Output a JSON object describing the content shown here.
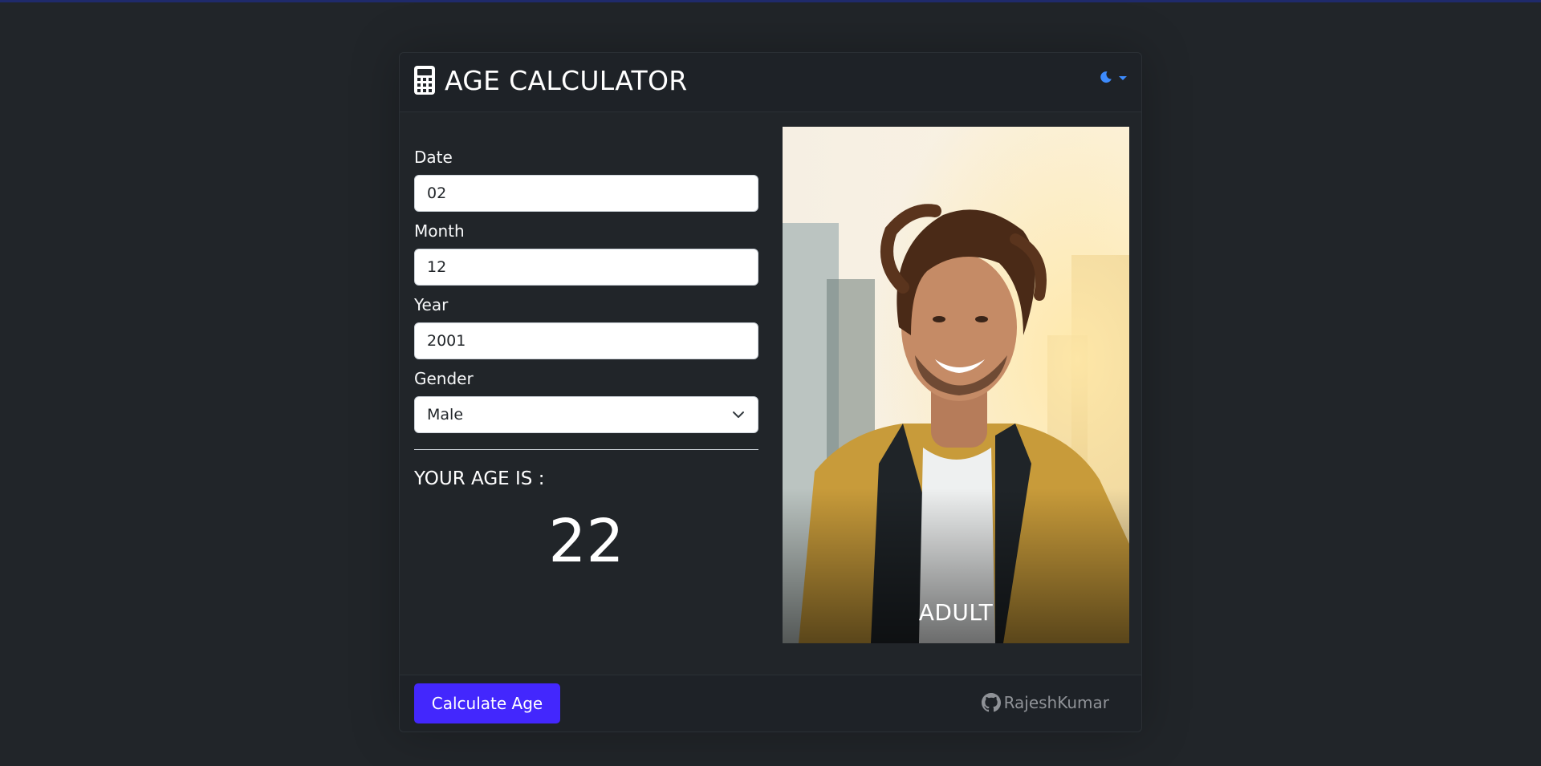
{
  "header": {
    "title": "AGE CALCULATOR",
    "title_icon": "calculator-icon",
    "theme_icon": "moon-icon"
  },
  "form": {
    "date_label": "Date",
    "date_value": "02",
    "month_label": "Month",
    "month_value": "12",
    "year_label": "Year",
    "year_value": "2001",
    "gender_label": "Gender",
    "gender_value": "Male"
  },
  "result": {
    "heading": "YOUR AGE IS :",
    "age": "22",
    "category": "ADULT"
  },
  "footer": {
    "calculate_label": "Calculate Age",
    "github_name": "RajeshKumar",
    "github_icon": "github-icon"
  },
  "colors": {
    "background": "#212529",
    "button": "#4327fd",
    "accent": "#3d8bfd"
  }
}
